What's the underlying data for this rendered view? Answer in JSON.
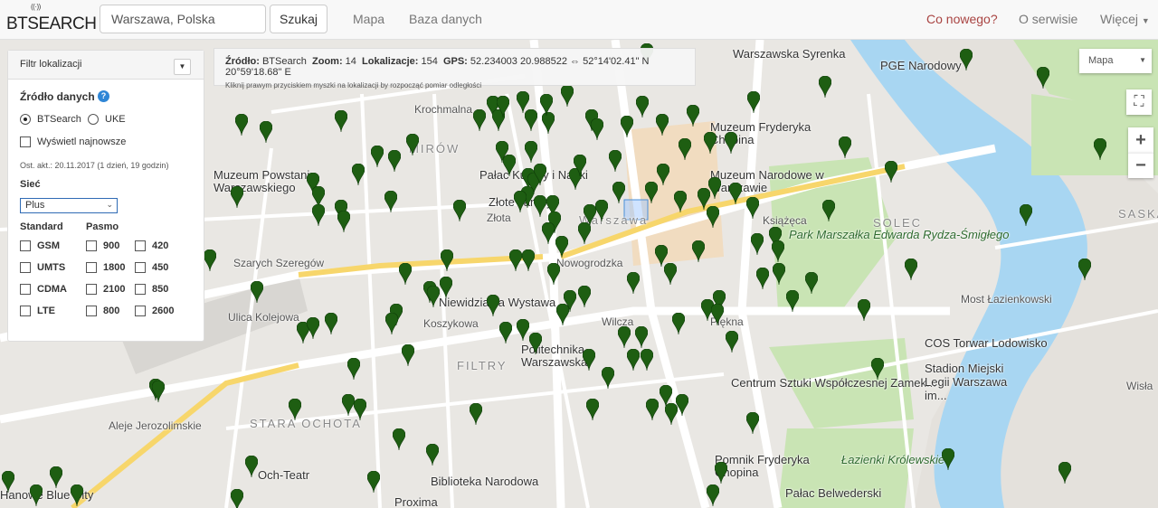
{
  "nav": {
    "logo": "BTSEARCH",
    "logo_waves": "((·))",
    "search_value": "Warszawa, Polska",
    "search_button": "Szukaj",
    "links": [
      "Mapa",
      "Baza danych"
    ],
    "right_links": [
      "Co nowego?",
      "O serwisie",
      "Więcej"
    ],
    "accent": "#a94442"
  },
  "filter": {
    "title": "Filtr lokalizacji",
    "source_label": "Źródło danych",
    "help": "?",
    "source_options": [
      "BTSearch",
      "UKE"
    ],
    "show_newest": "Wyświetl najnowsze",
    "last_update": "Ost. akt.: 20.11.2017 (1 dzień, 19 godzin)",
    "network_label": "Sieć",
    "network_value": "Plus",
    "standard_label": "Standard",
    "band_label": "Pasmo",
    "standards": [
      "GSM",
      "UMTS",
      "CDMA",
      "LTE"
    ],
    "bands_col1": [
      "900",
      "1800",
      "2100",
      "800"
    ],
    "bands_col2": [
      "420",
      "450",
      "850",
      "2600"
    ]
  },
  "info": {
    "source_k": "Źródło:",
    "source_v": "BTSearch",
    "zoom_k": "Zoom:",
    "zoom_v": "14",
    "loc_k": "Lokalizacje:",
    "loc_v": "154",
    "gps_k": "GPS:",
    "gps_v": "52.234003 20.988522 ⇔ 52°14'02.41\" N 20°59'18.68\" E",
    "hint": "Kliknij prawym przyciskiem myszki na lokalizacji by rozpocząć pomiar odległości"
  },
  "map": {
    "type_select": "Mapa",
    "zoom_in": "+",
    "zoom_out": "−",
    "fullscreen": "⛶",
    "marker_color": "#1e5e12",
    "labels": [
      "Warszawa",
      "Muzeum Powstania Warszawskiego",
      "Pałac Kultury i Nauki",
      "Złote Tarasy",
      "Muzeum Fryderyka Chopina",
      "Muzeum Narodowe w Warszawie",
      "PGE Narodowy",
      "Warszawska Syrenka",
      "MIRÓW",
      "SOLEC",
      "SASKA",
      "Park Marszałka Edwarda Rydza-Śmigłego",
      "Niewidzialna Wystawa",
      "Politechnika Warszawska",
      "FILTRY",
      "STARA OCHOTA",
      "Centrum Sztuki Współczesnej Zamek...",
      "COS Torwar Lodowisko",
      "Stadion Miejski Legii Warszawa im...",
      "Pomnik Fryderyka Chopina",
      "Łazienki Królewskie",
      "Pałac Belwederski",
      "Och-Teatr",
      "Biblioteka Narodowa",
      "Proxima",
      "Hanowe Blue City",
      "Ulica Kolejowa",
      "Koszykowa",
      "Złota",
      "Wisła",
      "Most Łazienkowski",
      "Aleje Jerozolimskie",
      "Krochmalna",
      "Szarych Szeregów",
      "Nowogrodzka",
      "Piękna",
      "Wilcza",
      "Książęca"
    ]
  }
}
